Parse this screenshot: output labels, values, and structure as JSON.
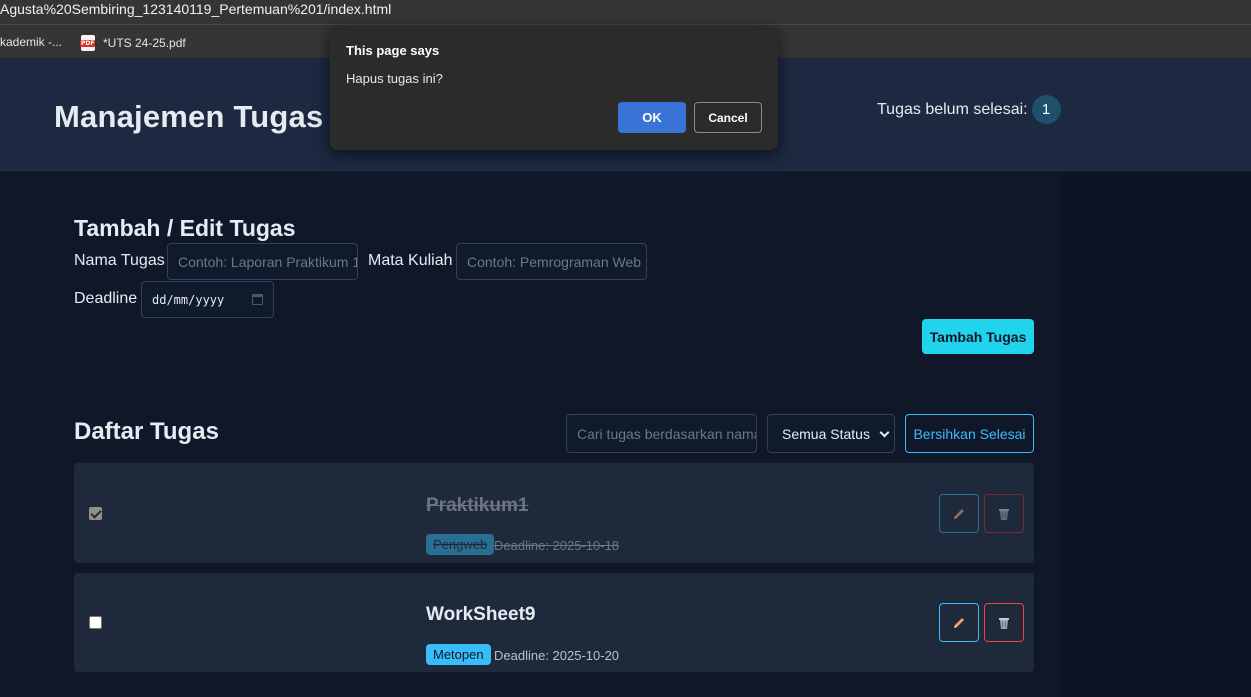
{
  "browser": {
    "url": "Agusta%20Sembiring_123140119_Pertemuan%201/index.html",
    "bookmarks": [
      {
        "label": "kademik -..."
      },
      {
        "label": "*UTS 24-25.pdf"
      }
    ]
  },
  "header": {
    "title": "Manajemen Tugas",
    "pending_label": "Tugas belum selesai:",
    "pending_count": "1"
  },
  "form": {
    "title": "Tambah / Edit Tugas",
    "name_label": "Nama Tugas",
    "name_placeholder": "Contoh: Laporan Praktikum 1",
    "course_label": "Mata Kuliah",
    "course_placeholder": "Contoh: Pemrograman Web",
    "deadline_label": "Deadline",
    "deadline_placeholder": "dd/mm/yyyy",
    "submit_label": "Tambah Tugas"
  },
  "list": {
    "title": "Daftar Tugas",
    "search_placeholder": "Cari tugas berdasarkan nama",
    "filter_selected": "Semua Status",
    "clear_label": "Bersihkan Selesai",
    "tasks": [
      {
        "name": "Praktikum1",
        "course": "Pengweb",
        "deadline": "Deadline: 2025-10-18",
        "completed": true
      },
      {
        "name": "WorkSheet9",
        "course": "Metopen",
        "deadline": "Deadline: 2025-10-20",
        "completed": false
      }
    ]
  },
  "dialog": {
    "title": "This page says",
    "message": "Hapus tugas ini?",
    "ok_label": "OK",
    "cancel_label": "Cancel"
  },
  "colors": {
    "accent": "#22d3ee",
    "link": "#38bdf8",
    "danger": "#ef4444",
    "background": "#0f1729",
    "card": "#1e293b"
  }
}
